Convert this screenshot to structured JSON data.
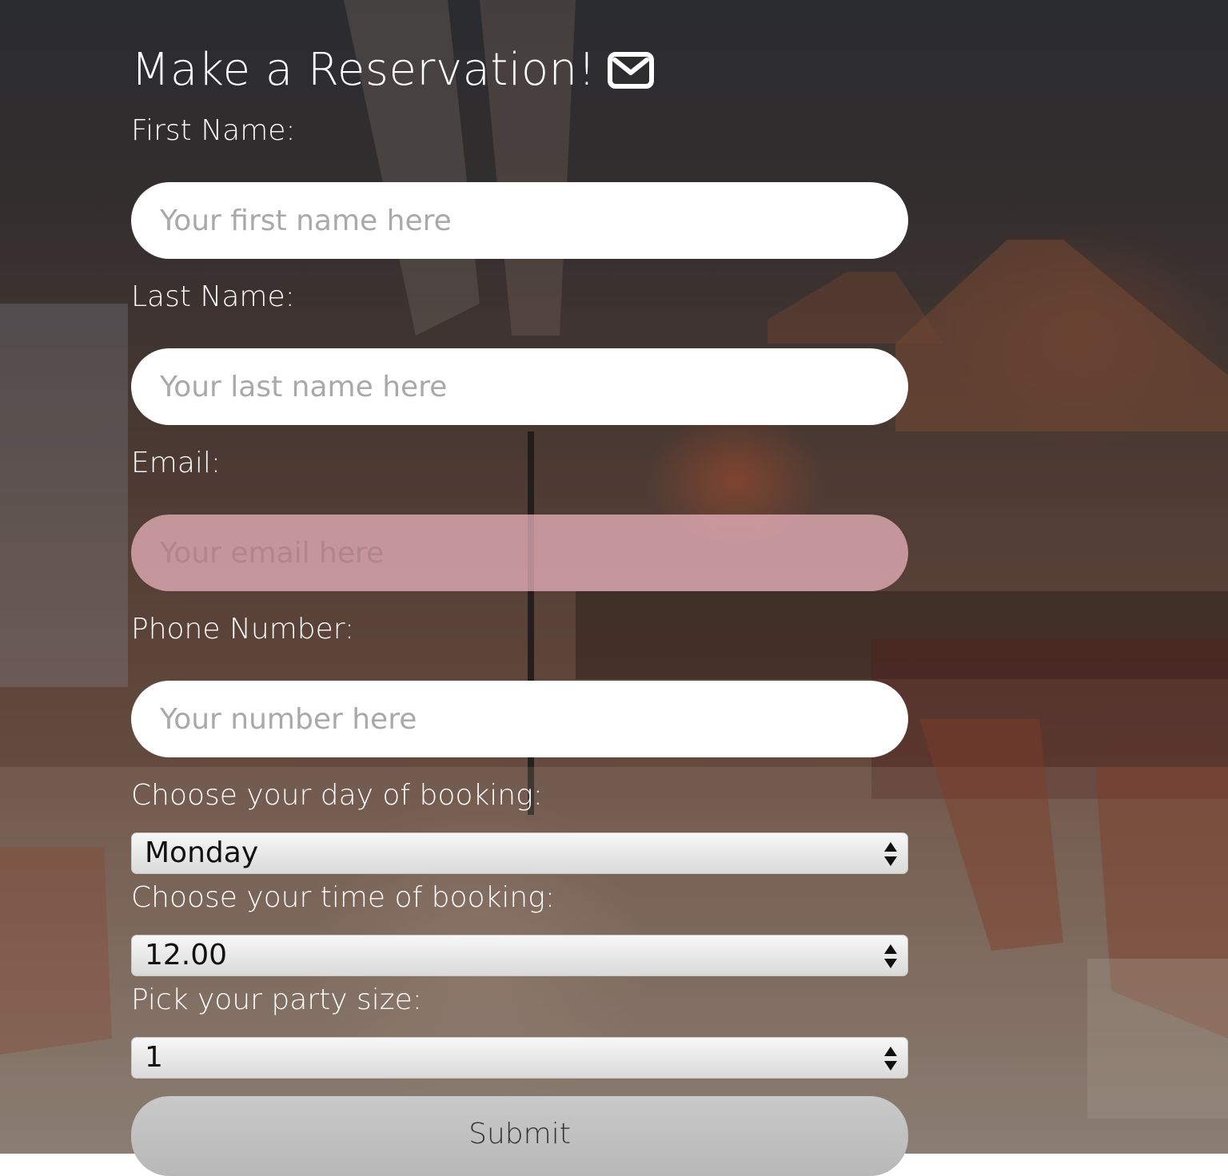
{
  "page": {
    "title": "Make a Reservation!",
    "title_icon": "envelope-icon"
  },
  "form": {
    "first_name": {
      "label": "First Name:",
      "placeholder": "Your first name here"
    },
    "last_name": {
      "label": "Last Name:",
      "placeholder": "Your last name here"
    },
    "email": {
      "label": "Email:",
      "placeholder": "Your email here"
    },
    "phone": {
      "label": "Phone Number:",
      "placeholder": "Your number here"
    },
    "day": {
      "label": "Choose your day of booking:",
      "value": "Monday"
    },
    "time": {
      "label": "Choose your time of booking:",
      "value": "12.00"
    },
    "party": {
      "label": "Pick your party size:",
      "value": "1"
    },
    "submit_label": "Submit"
  },
  "colors": {
    "text": "#ffffff",
    "input_bg": "#ffffff",
    "email_input_bg": "#f0b9c3",
    "placeholder": "#a9a9a9",
    "submit_bg": "#c2c2c2"
  }
}
